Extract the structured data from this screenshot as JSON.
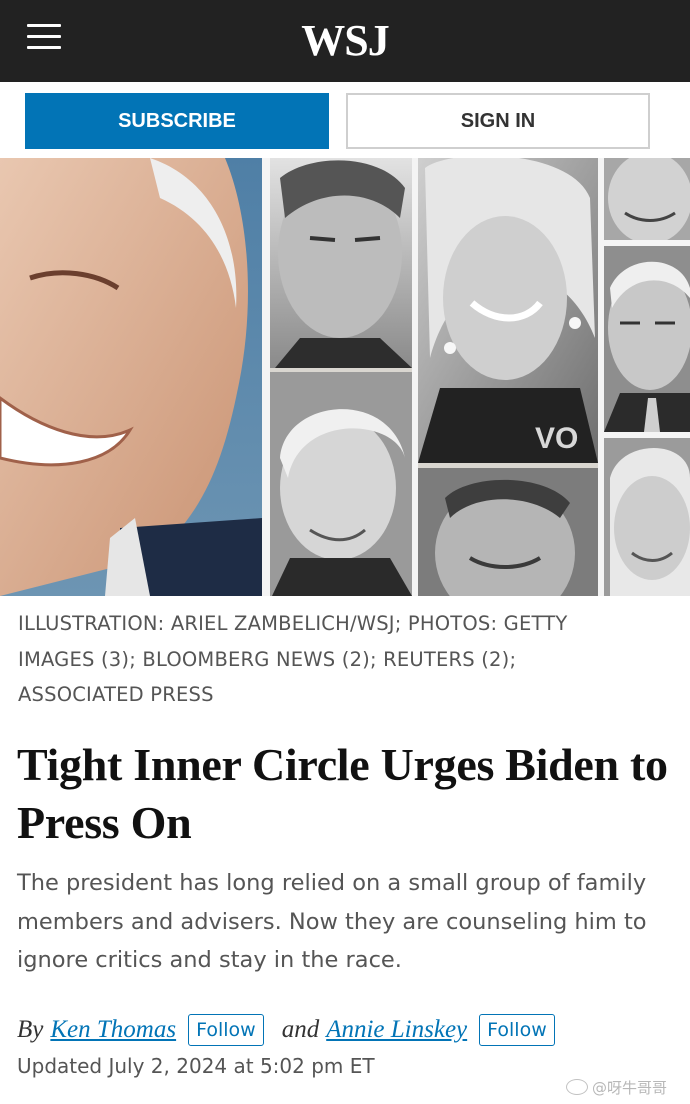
{
  "header": {
    "logo": "WSJ",
    "menu_icon": "hamburger-menu-icon"
  },
  "auth": {
    "subscribe_label": "SUBSCRIBE",
    "signin_label": "SIGN IN"
  },
  "colors": {
    "topbar": "#222222",
    "accent": "#0274b6",
    "caption_text": "#555555"
  },
  "hero": {
    "caption": "ILLUSTRATION: ARIEL ZAMBELICH/WSJ; PHOTOS: GETTY IMAGES (3); BLOOMBERG NEWS (2); REUTERS (2); ASSOCIATED PRESS"
  },
  "article": {
    "headline": "Tight Inner Circle Urges Biden to Press On",
    "dek": "The president has long relied on a small group of family members and advisers. Now they are counseling him to ignore critics and stay in the race.",
    "byline": {
      "by": "By",
      "author1": "Ken Thomas",
      "follow1": "Follow",
      "and": "and",
      "author2": "Annie Linskey",
      "follow2": "Follow"
    },
    "updated": "Updated July 2, 2024 at 5:02 pm ET"
  },
  "watermark": {
    "text": "@呀牛哥哥"
  }
}
